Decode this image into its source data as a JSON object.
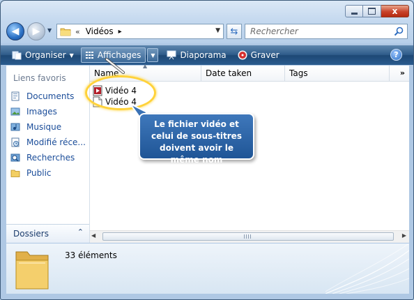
{
  "window": {
    "title_buttons": {
      "minimize_icon": "minimize-icon",
      "maximize_icon": "maximize-icon",
      "close_label": "x"
    }
  },
  "navigation": {
    "address": {
      "separator": "«",
      "location": "Vidéos",
      "trail_arrow": "▸"
    },
    "search": {
      "placeholder": "Rechercher"
    }
  },
  "toolbar": {
    "organise": "Organiser",
    "views": "Affichages",
    "slideshow": "Diaporama",
    "burn": "Graver",
    "help": "?"
  },
  "sidebar": {
    "title": "Liens favoris",
    "items": [
      {
        "label": "Documents",
        "icon": "documents-icon"
      },
      {
        "label": "Images",
        "icon": "pictures-icon"
      },
      {
        "label": "Musique",
        "icon": "music-icon"
      },
      {
        "label": "Modifié réce...",
        "icon": "recently-changed-icon"
      },
      {
        "label": "Recherches",
        "icon": "searches-icon"
      },
      {
        "label": "Public",
        "icon": "public-folder-icon"
      }
    ],
    "folders_label": "Dossiers"
  },
  "columns": [
    "Name",
    "Date taken",
    "Tags",
    "»"
  ],
  "files": [
    {
      "name": "Vidéo 4",
      "icon": "video-file-icon"
    },
    {
      "name": "Vidéo 4",
      "icon": "blank-file-icon"
    }
  ],
  "callout": {
    "text": "Le fichier vidéo et celui de sous-titres doivent avoir le même nom"
  },
  "details": {
    "count": "33 éléments"
  },
  "colors": {
    "toolbar": "#2f5c8a",
    "link": "#1a4c99",
    "callout": "#2a63a6",
    "highlight": "#ffd23a"
  }
}
